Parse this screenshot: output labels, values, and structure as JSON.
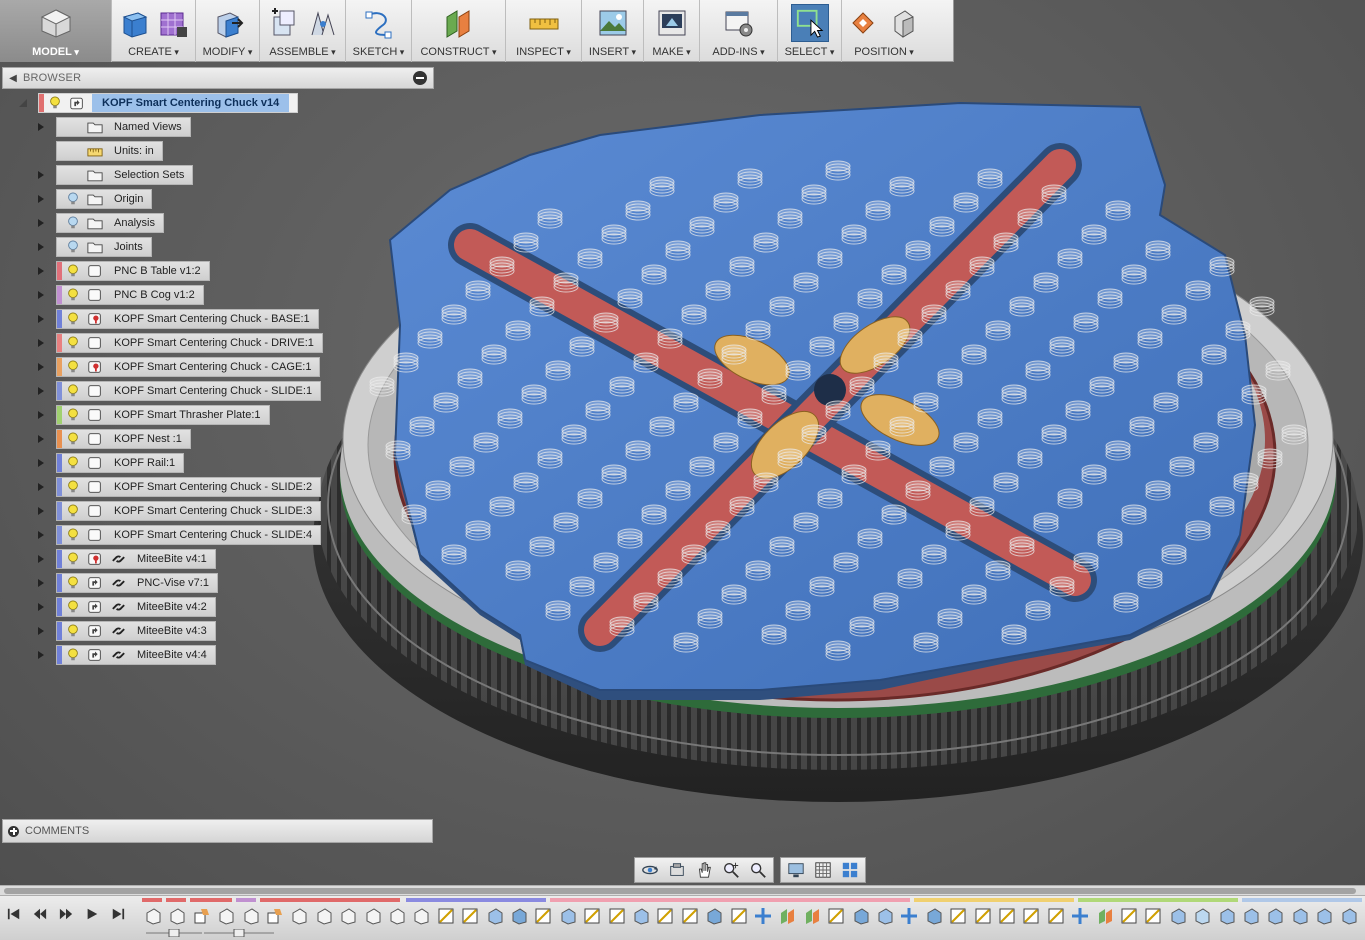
{
  "toolbar": {
    "model": "MODEL",
    "create": "CREATE",
    "modify": "MODIFY",
    "assemble": "ASSEMBLE",
    "sketch": "SKETCH",
    "construct": "CONSTRUCT",
    "inspect": "INSPECT",
    "insert": "INSERT",
    "make": "MAKE",
    "addins": "ADD-INS",
    "select": "SELECT",
    "position": "POSITION"
  },
  "browser": {
    "title": "BROWSER",
    "root": "KOPF Smart Centering Chuck v14",
    "items": [
      {
        "label": "Named Views",
        "kind": "folder",
        "bulb": false,
        "color": ""
      },
      {
        "label": "Units: in",
        "kind": "units",
        "bulb": false,
        "color": ""
      },
      {
        "label": "Selection Sets",
        "kind": "folder",
        "bulb": false,
        "color": ""
      },
      {
        "label": "Origin",
        "kind": "folder",
        "bulb": true,
        "color": ""
      },
      {
        "label": "Analysis",
        "kind": "folder",
        "bulb": true,
        "color": ""
      },
      {
        "label": "Joints",
        "kind": "folder",
        "bulb": true,
        "color": ""
      },
      {
        "label": "PNC B Table v1:2",
        "kind": "component",
        "bulb": true,
        "color": "#e0707a"
      },
      {
        "label": "PNC B Cog v1:2",
        "kind": "component",
        "bulb": true,
        "color": "#c090d0"
      },
      {
        "label": "KOPF Smart Centering Chuck - BASE:1",
        "kind": "component-pinned",
        "bulb": true,
        "color": "#7080d8"
      },
      {
        "label": "KOPF Smart Centering Chuck - DRIVE:1",
        "kind": "component",
        "bulb": true,
        "color": "#e88080"
      },
      {
        "label": "KOPF Smart Centering Chuck - CAGE:1",
        "kind": "component-pinned",
        "bulb": true,
        "color": "#e8a060"
      },
      {
        "label": "KOPF Smart Centering Chuck - SLIDE:1",
        "kind": "component",
        "bulb": true,
        "color": "#8090d8"
      },
      {
        "label": "KOPF Smart Thrasher Plate:1",
        "kind": "component",
        "bulb": true,
        "color": "#a0d070"
      },
      {
        "label": "KOPF Nest :1",
        "kind": "component",
        "bulb": true,
        "color": "#e89050"
      },
      {
        "label": "KOPF Rail:1",
        "kind": "component",
        "bulb": true,
        "color": "#7080d8"
      },
      {
        "label": "KOPF Smart Centering Chuck - SLIDE:2",
        "kind": "component",
        "bulb": true,
        "color": "#8090d8"
      },
      {
        "label": "KOPF Smart Centering Chuck - SLIDE:3",
        "kind": "component",
        "bulb": true,
        "color": "#8090d8"
      },
      {
        "label": "KOPF Smart Centering Chuck - SLIDE:4",
        "kind": "component",
        "bulb": true,
        "color": "#8090d8"
      },
      {
        "label": "MiteeBite v4:1",
        "kind": "linked-pinned",
        "bulb": true,
        "color": "#7080d8"
      },
      {
        "label": "PNC-Vise v7:1",
        "kind": "linked",
        "bulb": true,
        "color": "#7080d8"
      },
      {
        "label": "MiteeBite v4:2",
        "kind": "linked",
        "bulb": true,
        "color": "#7080d8"
      },
      {
        "label": "MiteeBite v4:3",
        "kind": "linked",
        "bulb": true,
        "color": "#7080d8"
      },
      {
        "label": "MiteeBite v4:4",
        "kind": "linked",
        "bulb": true,
        "color": "#7080d8"
      }
    ]
  },
  "comments": {
    "label": "COMMENTS"
  },
  "navbar": {
    "orbit": "orbit-icon",
    "look_at": "look-at-icon",
    "pan": "pan-icon",
    "zoom": "zoom-icon",
    "fit": "zoom-window-icon",
    "display": "display-settings-icon",
    "grid": "grid-icon",
    "viewports": "viewports-icon"
  },
  "timeline": {
    "controls": [
      "skip-to-start-icon",
      "step-back-icon",
      "play-icon",
      "step-forward-icon",
      "skip-to-end-icon"
    ]
  },
  "colors": {
    "selection_blue": "#4a7fb7",
    "root_highlight": "#9cc0ea",
    "plate_blue": "#4f7fc8",
    "slot_red": "#c0504d",
    "jaw_orange": "#e0b060",
    "ring_green": "#2e6b3a"
  }
}
